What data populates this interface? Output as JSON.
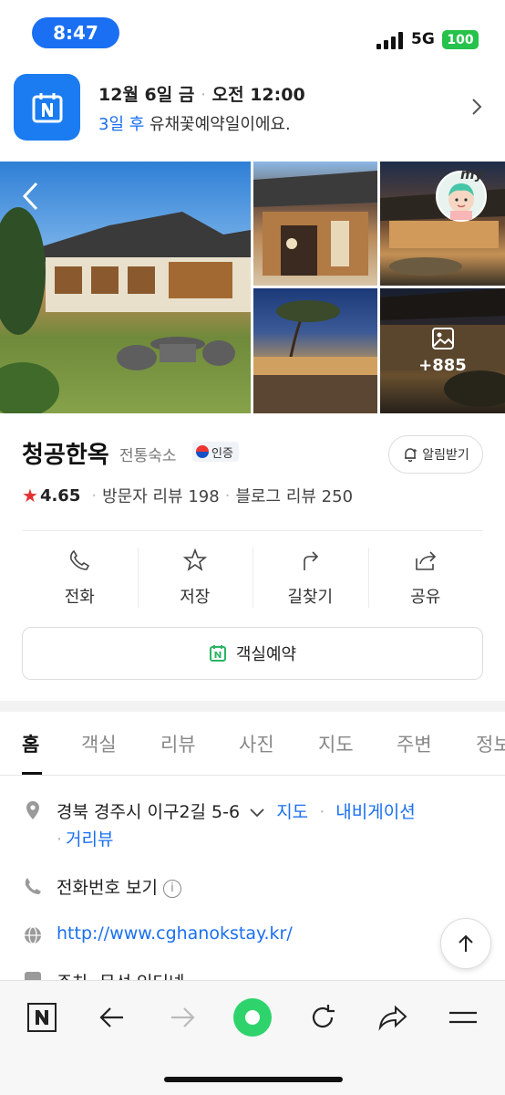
{
  "status_bar": {
    "time": "8:47",
    "network": "5G",
    "battery": "100"
  },
  "banner": {
    "date": "12월 6일 금",
    "time": "오전 12:00",
    "sub_highlight": "3일 후",
    "sub_rest": " 유채꽃예약일이에요."
  },
  "photos": {
    "more_count": "+885",
    "my_label": "my"
  },
  "place": {
    "name": "청공한옥",
    "category": "전통숙소",
    "cert_label": "인증",
    "alarm_label": "알림받기",
    "rating": "4.65",
    "visitor_reviews": "방문자 리뷰 198",
    "blog_reviews": "블로그 리뷰 250"
  },
  "actions": [
    {
      "label": "전화",
      "icon": "phone-icon"
    },
    {
      "label": "저장",
      "icon": "star-icon"
    },
    {
      "label": "길찾기",
      "icon": "directions-icon"
    },
    {
      "label": "공유",
      "icon": "share-icon"
    }
  ],
  "book_button": "객실예약",
  "tabs": [
    "홈",
    "객실",
    "리뷰",
    "사진",
    "지도",
    "주변",
    "정보"
  ],
  "info": {
    "address": "경북 경주시 이구2길 5-6",
    "map_link": "지도",
    "navi_link": "내비게이션",
    "street_view_link": "거리뷰",
    "phone_label": "전화번호 보기",
    "website": "http://www.cghanokstay.kr/",
    "cut_text": "주차, 무선 인터넷"
  },
  "colors": {
    "accent": "#1a6ff2",
    "star": "#e53030",
    "green": "#2ed46b"
  }
}
